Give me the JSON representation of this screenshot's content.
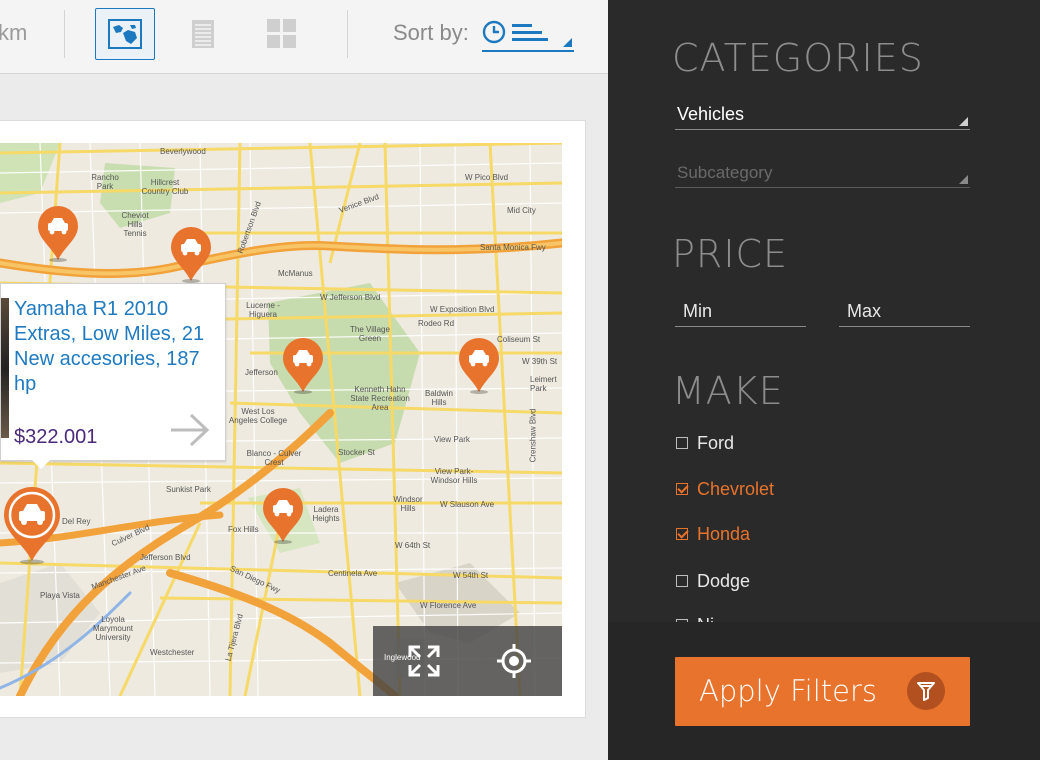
{
  "toolbar": {
    "unit_text": "km",
    "views": [
      {
        "name": "map-view",
        "icon": "map-icon",
        "active": true
      },
      {
        "name": "list-view",
        "icon": "list-icon",
        "active": false
      },
      {
        "name": "grid-view",
        "icon": "grid-icon",
        "active": false
      }
    ],
    "sort_label": "Sort by:",
    "sort_icon": "clock-sort-icon",
    "accent_color": "#1c79c0"
  },
  "map": {
    "labels": [
      "Beverlywood",
      "Rancho Park",
      "Hillcrest Country Club",
      "Cheviot Hills Tennis",
      "W Pico Blvd",
      "Mid City",
      "Santa Monica Fwy",
      "McManus",
      "W Jefferson Blvd",
      "Lucerne - Higuera",
      "W Exposition Blvd",
      "Rodeo Rd",
      "The Village Green",
      "Coliseum St",
      "W 39th St",
      "Jefferson",
      "Leimert Park",
      "Kenneth Hahn State Recreation Area",
      "Baldwin Hills",
      "West Los Angeles College",
      "View Park",
      "Blanco - Culver Crest",
      "Stocker St",
      "View Park-Windsor Hills",
      "Sunkist Park",
      "Del Rey",
      "Windsor Hills",
      "W Slauson Ave",
      "Fox Hills",
      "Ladera Heights",
      "W 64th St",
      "Centinela Ave",
      "Playa Vista",
      "Loyola Marymount University",
      "W Florence Ave",
      "Westchester",
      "Inglewood",
      "W 54th St",
      "Crenshaw Blvd",
      "Venice Blvd",
      "Robertson Blvd",
      "Jefferson Blvd",
      "Culver Blvd",
      "San Diego Fwy",
      "La Tijera Blvd",
      "Manchester Ave"
    ],
    "pin_icon": "car-icon",
    "pin_color": "#e8732c",
    "popup": {
      "title": "Yamaha R1 2010 Extras, Low Miles, 21 New accesories, 187 hp",
      "price": "$322.001",
      "arrow_icon": "arrow-right-icon"
    },
    "controls": [
      "expand-icon",
      "locate-icon"
    ]
  },
  "filters": {
    "categories_title": "CATEGORIES",
    "category_value": "Vehicles",
    "subcategory_placeholder": "Subcategory",
    "price_title": "PRICE",
    "price_min_placeholder": "Min",
    "price_max_placeholder": "Max",
    "make_title": "MAKE",
    "makes": [
      {
        "label": "Ford",
        "checked": false
      },
      {
        "label": "Chevrolet",
        "checked": true
      },
      {
        "label": "Honda",
        "checked": true
      },
      {
        "label": "Dodge",
        "checked": false
      },
      {
        "label": "Ni",
        "checked": false
      }
    ],
    "apply_label": "Apply Filters",
    "apply_icon": "filter-icon",
    "accent_color": "#e8732c"
  }
}
